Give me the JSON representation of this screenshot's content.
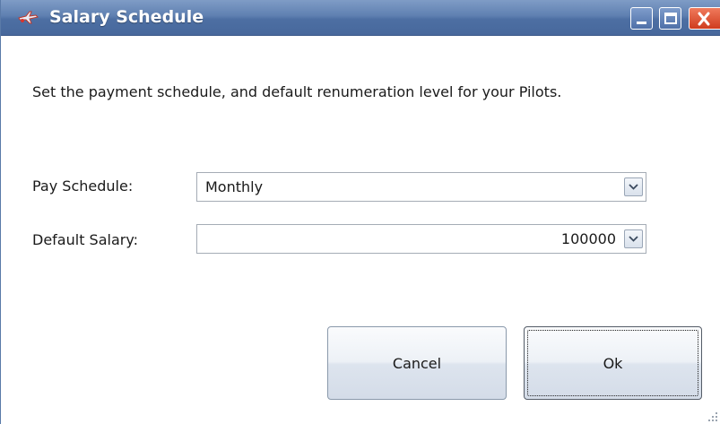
{
  "window": {
    "title": "Salary Schedule",
    "icons": {
      "app": "plane-icon",
      "minimize": "minimize-icon",
      "maximize": "maximize-icon",
      "close": "close-icon"
    }
  },
  "content": {
    "description": "Set the payment schedule, and default renumeration level for your Pilots."
  },
  "form": {
    "pay_schedule": {
      "label": "Pay Schedule:",
      "value": "Monthly"
    },
    "default_salary": {
      "label": "Default Salary:",
      "value": "100000"
    }
  },
  "buttons": {
    "cancel": "Cancel",
    "ok": "Ok"
  },
  "colors": {
    "titlebar": "#5f80b1",
    "close_button": "#cf3c1e",
    "button_face": "#edf1f6"
  }
}
